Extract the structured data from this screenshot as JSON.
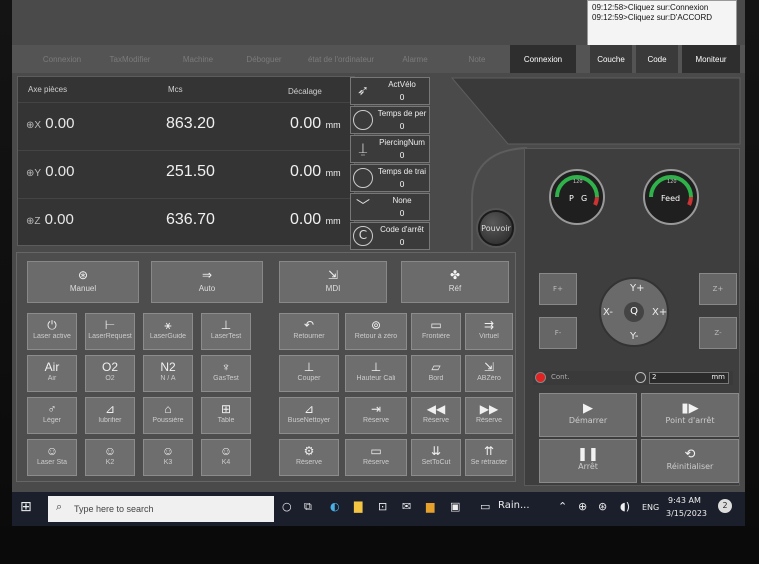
{
  "log": {
    "lines": [
      "09:12:58>Cliquez sur:Connexion",
      "09:12:59>Cliquez sur:D'ACCORD"
    ]
  },
  "tabs": [
    "Connexion",
    "TaxModifier",
    "Machine",
    "Déboguer",
    "état de l'ordinateur",
    "Alarme",
    "Note",
    "Connexion",
    "Couche",
    "Code",
    "Moniteur"
  ],
  "axes": {
    "headers": {
      "axis": "Axe  pièces",
      "mcs": "Mcs",
      "offset": "Décalage"
    },
    "rows": [
      {
        "name": "X",
        "val": "0.00",
        "mcs": "863.20",
        "off": "0.00",
        "unit": "mm"
      },
      {
        "name": "Y",
        "val": "0.00",
        "mcs": "251.50",
        "off": "0.00",
        "unit": "mm"
      },
      {
        "name": "Z",
        "val": "0.00",
        "mcs": "636.70",
        "off": "0.00",
        "unit": "mm"
      }
    ]
  },
  "params": [
    {
      "label": "ActVélo",
      "value": "0"
    },
    {
      "label": "Temps de per",
      "value": "0"
    },
    {
      "label": "PiercingNum",
      "value": "0"
    },
    {
      "label": "Temps de trai",
      "value": "0"
    },
    {
      "label": "None",
      "value": "0"
    },
    {
      "label": "Code d'arrêt",
      "value": "0"
    }
  ],
  "pouvoir": "Pouvoir",
  "modes": [
    "Manuel",
    "Auto",
    "MDI",
    "Réf"
  ],
  "grid_left": [
    [
      "Laser active",
      "LaserRequest",
      "LaserGuide",
      "LaserTest"
    ],
    [
      "Air",
      "O2",
      "N / A",
      "GasTest"
    ],
    [
      "Léger",
      "lubrifier",
      "Poussière",
      "Table"
    ],
    [
      "Laser Sta",
      "K2",
      "K3",
      "K4"
    ]
  ],
  "grid_left_top": {
    "r2": [
      "Air",
      "O2",
      "N2",
      ""
    ]
  },
  "grid_right": [
    [
      "Retourner",
      "Retour à zéro",
      "Frontière",
      "Virtuel"
    ],
    [
      "Couper",
      "Hauteur Cali",
      "Bord",
      "ABZéro"
    ],
    [
      "BuseNettoyer",
      "Réserve",
      "Réserve",
      "Réserve"
    ],
    [
      "Réserve",
      "Réserve",
      "SetToCut",
      "Se rétracter"
    ]
  ],
  "gauges": [
    {
      "name": "PG",
      "labels": [
        "P",
        "G"
      ],
      "max": "120"
    },
    {
      "name": "Feed",
      "labels": [
        "Feed"
      ],
      "max": "120"
    }
  ],
  "jog": {
    "fplus": "F+",
    "fminus": "F-",
    "zplus": "Z+",
    "zminus": "Z-",
    "yplus": "Y+",
    "yminus": "Y-",
    "xplus": "X+",
    "xminus": "X-",
    "center": "Q"
  },
  "speed": {
    "label": "Cont.",
    "value": "2",
    "unit": "mm"
  },
  "controls": [
    "Démarrer",
    "Point d'arrêt",
    "Arrêt",
    "Réinitialiser"
  ],
  "taskbar": {
    "search": "Type here to search",
    "app": "Rain...",
    "lang": "ENG",
    "time": "9:43 AM",
    "date": "3/15/2023",
    "badge": "2"
  }
}
